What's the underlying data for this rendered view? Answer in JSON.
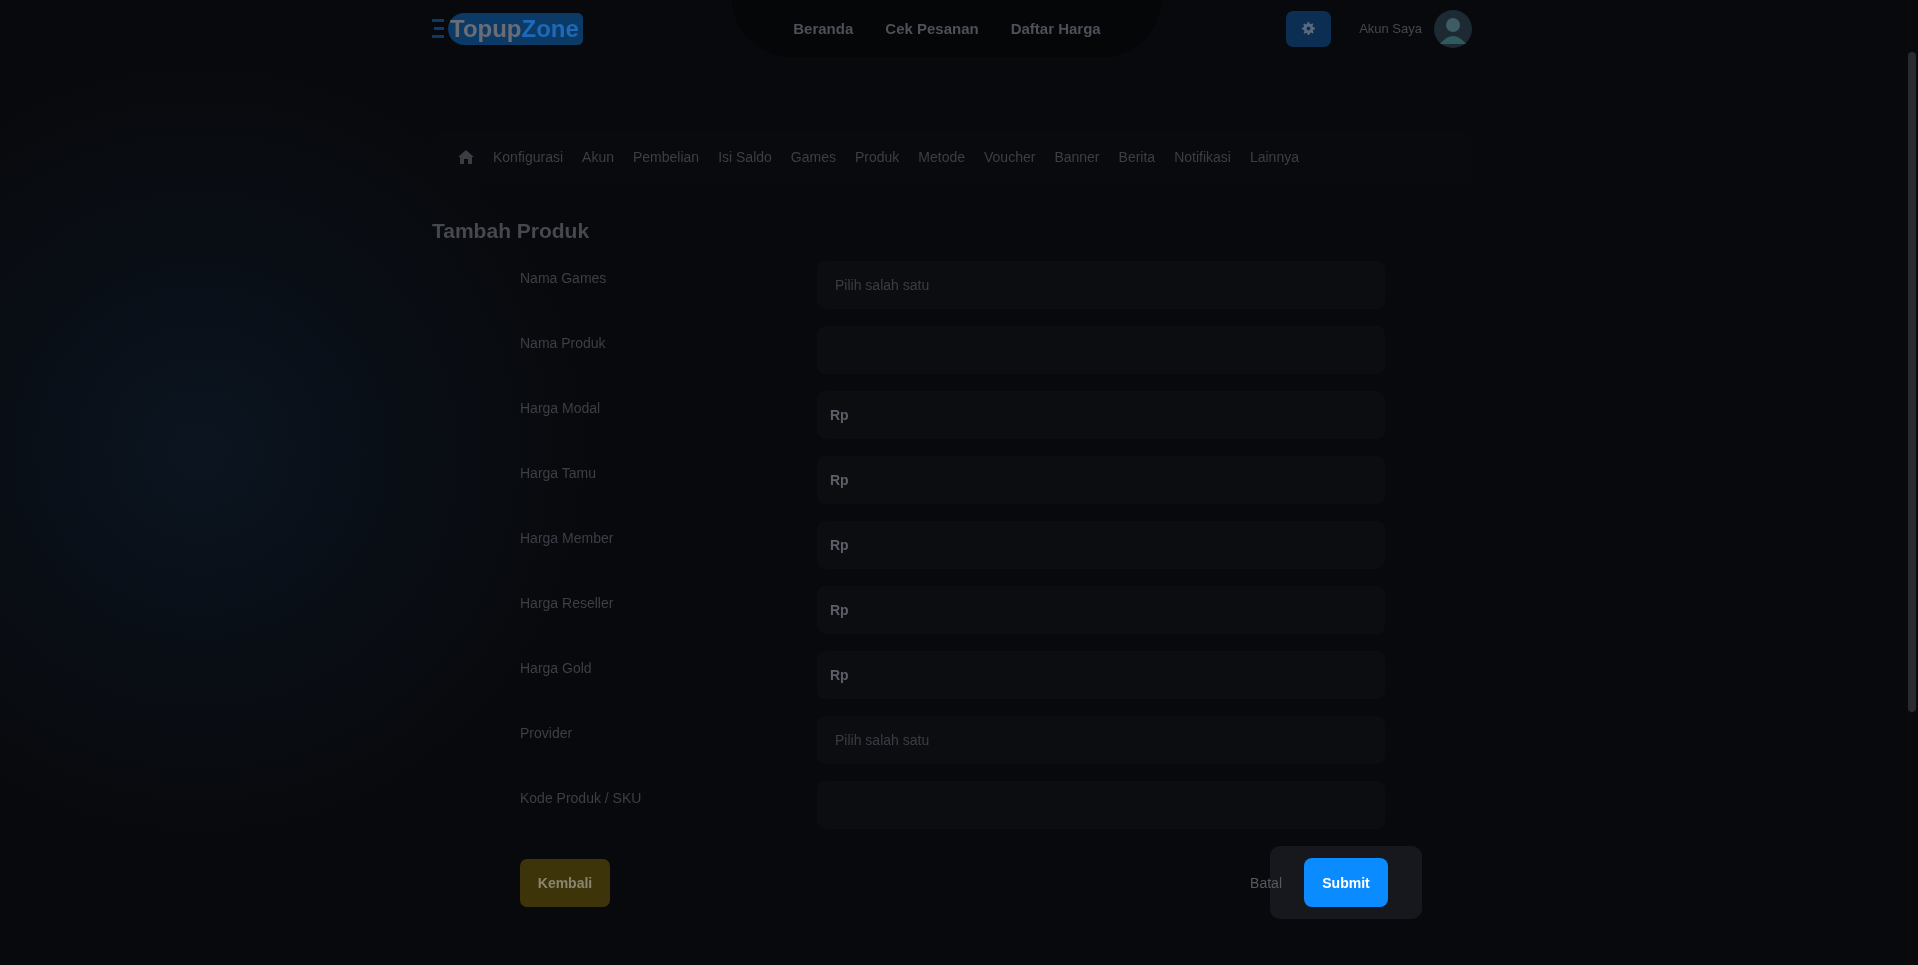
{
  "header": {
    "logo": {
      "part1": "Topup",
      "part2": "Zone"
    },
    "nav": [
      "Beranda",
      "Cek Pesanan",
      "Daftar Harga"
    ],
    "account": "Akun Saya"
  },
  "admin_menu": [
    "Konfigurasi",
    "Akun",
    "Pembelian",
    "Isi Saldo",
    "Games",
    "Produk",
    "Metode",
    "Voucher",
    "Banner",
    "Berita",
    "Notifikasi",
    "Lainnya"
  ],
  "title": "Tambah Produk",
  "fields": [
    {
      "label": "Nama Games",
      "kind": "select",
      "placeholder": "Pilih salah satu"
    },
    {
      "label": "Nama Produk",
      "kind": "text"
    },
    {
      "label": "Harga Modal",
      "kind": "currency",
      "prefix": "Rp"
    },
    {
      "label": "Harga Tamu",
      "kind": "currency",
      "prefix": "Rp"
    },
    {
      "label": "Harga Member",
      "kind": "currency",
      "prefix": "Rp"
    },
    {
      "label": "Harga Reseller",
      "kind": "currency",
      "prefix": "Rp"
    },
    {
      "label": "Harga Gold",
      "kind": "currency",
      "prefix": "Rp"
    },
    {
      "label": "Provider",
      "kind": "select",
      "placeholder": "Pilih salah satu"
    },
    {
      "label": "Kode Produk / SKU",
      "kind": "text"
    }
  ],
  "buttons": {
    "back": "Kembali",
    "cancel": "Batal",
    "submit": "Submit"
  }
}
